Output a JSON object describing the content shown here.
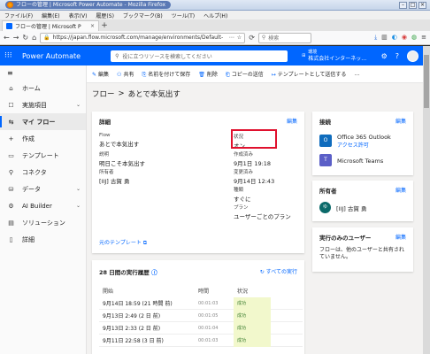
{
  "browser": {
    "window_title": "フローの管理 | Microsoft Power Automate - Mozilla Firefox",
    "menu": [
      "ファイル(F)",
      "編集(E)",
      "表示(V)",
      "履歴(S)",
      "ブックマーク(B)",
      "ツール(T)",
      "ヘルプ(H)"
    ],
    "tab_title": "フローの管理 | Microsoft P",
    "url": "https://japan.flow.microsoft.com/manage/environments/Default-",
    "search_placeholder": "検索"
  },
  "app": {
    "waffle": "⁝⁝⁝",
    "brand": "Power Automate",
    "search_placeholder": "役に立つリソースを検索してください",
    "env_label": "環境",
    "env_name": "株式会社インターネッ…",
    "colors": {
      "brand": "#0066ff",
      "success": "#3a7d2e",
      "highlight": "#e0112e"
    }
  },
  "sidebar": {
    "items": [
      {
        "label": "ホーム",
        "icon": "home-icon",
        "glyph": "⌂"
      },
      {
        "label": "実施項目",
        "icon": "action-items-icon",
        "glyph": "☐",
        "chevron": "⌄"
      },
      {
        "label": "マイ フロー",
        "icon": "my-flows-icon",
        "glyph": "⇆",
        "active": true
      },
      {
        "label": "作成",
        "icon": "create-icon",
        "glyph": "+"
      },
      {
        "label": "テンプレート",
        "icon": "templates-icon",
        "glyph": "▭"
      },
      {
        "label": "コネクタ",
        "icon": "connectors-icon",
        "glyph": "⚲"
      },
      {
        "label": "データ",
        "icon": "data-icon",
        "glyph": "⛁",
        "chevron": "⌄"
      },
      {
        "label": "AI Builder",
        "icon": "ai-builder-icon",
        "glyph": "⚙",
        "chevron": "⌄"
      },
      {
        "label": "ソリューション",
        "icon": "solutions-icon",
        "glyph": "▤"
      },
      {
        "label": "詳細",
        "icon": "learn-icon",
        "glyph": "▯"
      }
    ]
  },
  "commands": [
    "編集",
    "共有",
    "名前を付けて保存",
    "削除",
    "コピーの送信",
    "テンプレートとして送信する",
    "…"
  ],
  "breadcrumb": {
    "root": "フロー",
    "sep": ">",
    "current": "あとで本気出す"
  },
  "details": {
    "title": "詳細",
    "edit": "編集",
    "flow_label": "Flow",
    "flow_value": "あとで本気出す",
    "desc_label": "説明",
    "desc_value": "明日こそ本気出す",
    "owner_label": "所有者",
    "owner_value": "[IIJ] 古賀 勇",
    "status_label": "状況",
    "status_value": "オン",
    "created_label": "作成済み",
    "created_value": "9月1日 19:18",
    "modified_label": "変更済み",
    "modified_value": "9月14日 12:43",
    "type_label": "種類",
    "type_value": "すぐに",
    "plan_label": "プラン",
    "plan_value": "ユーザーごとのプラン",
    "template_link": "元のテンプレート"
  },
  "connections": {
    "title": "接続",
    "edit": "編集",
    "items": [
      {
        "name": "Office 365 Outlook",
        "sub": "アクセス許可",
        "color": "#0f6cbd",
        "icon": "outlook-icon"
      },
      {
        "name": "Microsoft Teams",
        "sub": "",
        "color": "#5b5fc7",
        "icon": "teams-icon"
      }
    ]
  },
  "owners": {
    "title": "所有者",
    "edit": "編集",
    "initials": "ゆ",
    "name": "[IIJ] 古賀 勇"
  },
  "run_only": {
    "title": "実行のみのユーザー",
    "edit": "編集",
    "text": "フローは、他のユーザーと共有されていません。"
  },
  "history": {
    "title": "28 日間の実行履歴",
    "all_runs": "すべての実行",
    "headers": {
      "start": "開始",
      "duration": "時間",
      "status": "状況"
    },
    "rows": [
      {
        "start": "9月14日 18:59 (21 時間 前)",
        "duration": "00:01:03",
        "status": "成功"
      },
      {
        "start": "9月13日 2:49 (2 日 前)",
        "duration": "00:01:05",
        "status": "成功"
      },
      {
        "start": "9月13日 2:33 (2 日 前)",
        "duration": "00:01:04",
        "status": "成功"
      },
      {
        "start": "9月11日 22:58 (3 日 前)",
        "duration": "00:01:03",
        "status": "成功"
      }
    ]
  }
}
